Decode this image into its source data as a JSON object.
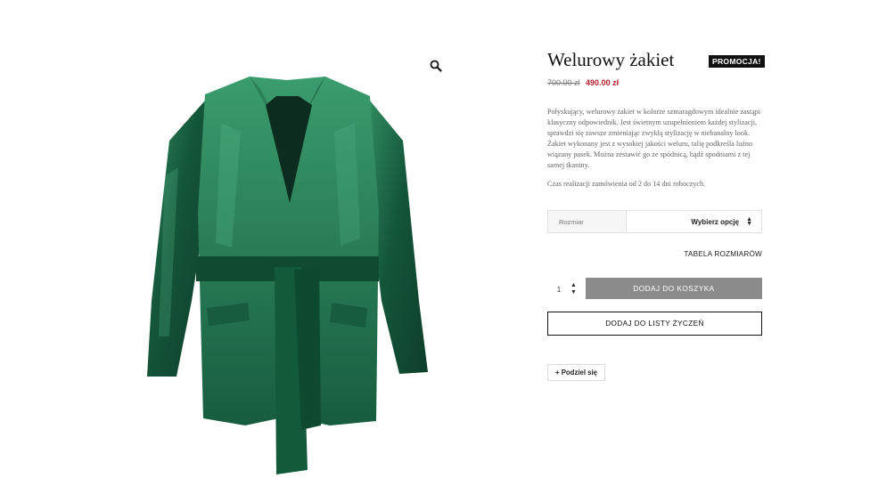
{
  "product": {
    "title": "Welurowy żakiet",
    "badge": "PROMOCJA!",
    "price_old": "700.00 zł",
    "price_new": "490.00 zł",
    "description": "Połyskujący, welurowy żakiet w kolorze szmaragdowym idealnie zastąpi klasyczny odpowiednik. Jest świetnym uzupełnieniem każdej stylizacji, sprawdzi się zawsze zmieniając zwykłą stylizację w niebanalny look. Żakiet wykonany jest z wysokiej jakości weluru, talię podkreśla luźno wiązany pasek. Można zestawić go ze spódnicą, bądź spodniami z tej samej tkaniny.",
    "lead_time": "Czas realizacji zamówienia od 2 do 14 dni roboczych."
  },
  "variation": {
    "label": "Rozmiar",
    "selected": "Wybierz opcję"
  },
  "size_chart_link": "TABELA ROZMIARÓW",
  "quantity": {
    "value": "1",
    "up": "▲",
    "down": "▼"
  },
  "buttons": {
    "add_to_cart": "DODAJ DO KOSZYKA",
    "add_to_wishlist": "DODAJ DO LISTY ŻYCZEŃ",
    "share": "+ Podziel się"
  },
  "icons": {
    "zoom": "magnifier-icon",
    "select_arrows": "updown-arrows-icon"
  },
  "colors": {
    "accent_price": "#b3202a",
    "cart_button": "#8b8b8b",
    "jacket": "#1f6b48"
  }
}
